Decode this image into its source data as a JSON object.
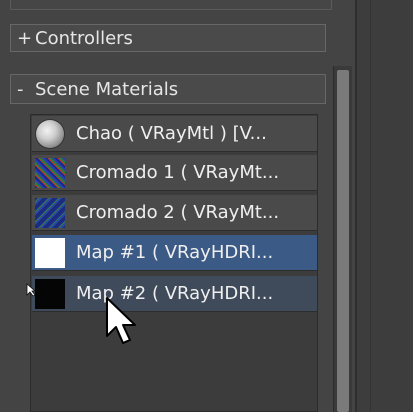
{
  "rollouts": {
    "controllers": {
      "sign": "+",
      "label": "Controllers"
    },
    "scene_materials": {
      "sign": "-",
      "label": "Scene Materials"
    }
  },
  "materials": [
    {
      "name": "Chao  ( VRayMtl ) [V...",
      "thumb": "sphere",
      "state": "normal"
    },
    {
      "name": "Cromado 1  ( VRayMt...",
      "thumb": "noise",
      "state": "normal"
    },
    {
      "name": "Cromado 2  ( VRayMt...",
      "thumb": "noise2",
      "state": "normal"
    },
    {
      "name": "Map #1  ( VRayHDRI...",
      "thumb": "white",
      "state": "selected"
    },
    {
      "name": "Map #2  ( VRayHDRI...",
      "thumb": "black",
      "state": "hover"
    }
  ],
  "icons": {
    "cursor": "arrow-cursor-icon"
  },
  "colors": {
    "selected_row": "#3b5a86",
    "hover_row": "#3f4a5a",
    "panel_bg": "#444444"
  }
}
